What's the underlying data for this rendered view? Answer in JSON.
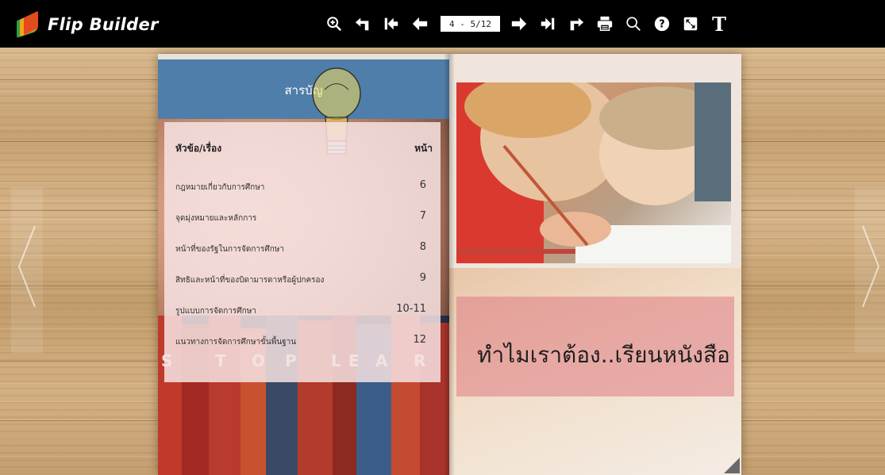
{
  "app": {
    "title": "Flip Builder"
  },
  "toolbar": {
    "page_indicator": "4 - 5/12",
    "buttons": [
      {
        "name": "zoom-in-icon"
      },
      {
        "name": "back-icon"
      },
      {
        "name": "first-page-icon"
      },
      {
        "name": "previous-page-icon"
      },
      {
        "name": "next-page-icon"
      },
      {
        "name": "last-page-icon"
      },
      {
        "name": "forward-icon"
      },
      {
        "name": "print-icon"
      },
      {
        "name": "search-icon"
      },
      {
        "name": "help-icon"
      },
      {
        "name": "fullscreen-icon"
      },
      {
        "name": "text-icon"
      }
    ],
    "text_button_label": "T"
  },
  "left_page": {
    "header_title": "สารบัญ",
    "toc": {
      "col_topic": "หัวข้อ/เรื่อง",
      "col_page": "หน้า",
      "rows": [
        {
          "topic": "กฎหมายเกี่ยวกับการศึกษา",
          "page": "6"
        },
        {
          "topic": "จุดมุ่งหมายและหลักการ",
          "page": "7"
        },
        {
          "topic": "หน้าที่ของรัฐในการจัดการศึกษา",
          "page": "8"
        },
        {
          "topic": "สิทธิและหน้าที่ของบิดามารดาหรือผู้ปกครอง",
          "page": "9"
        },
        {
          "topic": "รูปแบบการจัดการศึกษา",
          "page": "10-11"
        },
        {
          "topic": "แนวทางการจัดการศึกษาขั้นพื้นฐาน",
          "page": "12"
        }
      ]
    },
    "background_letters": [
      "S",
      "T",
      "O",
      "P",
      "L",
      "E",
      "A",
      "R"
    ]
  },
  "right_page": {
    "headline": "ทำไมเราต้อง..เรียนหนังสือ"
  },
  "colors": {
    "toolbar_bg": "#000000",
    "toc_header_blue": "#4f7eaa",
    "toc_panel_pink": "#f6e2e2",
    "headline_band": "#de7c84"
  }
}
